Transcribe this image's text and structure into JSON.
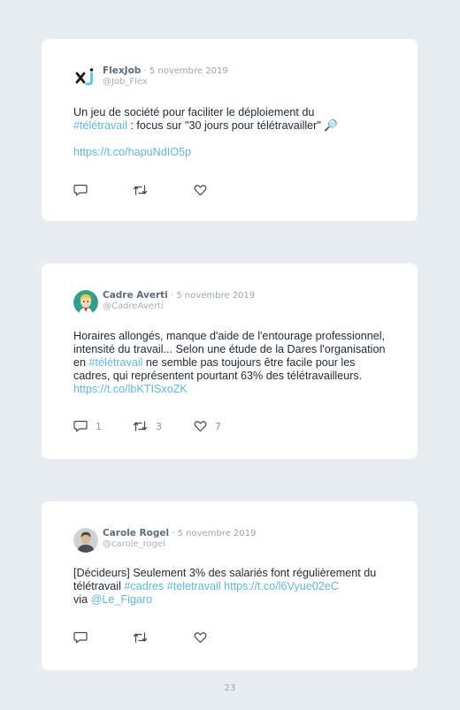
{
  "tweets": [
    {
      "author": "FlexJob",
      "date": " · 5 novembre 2019",
      "handle": "@Job_Flex",
      "avatar": "flexjob-logo",
      "text_a": "Un jeu de société pour faciliter le déploiement du",
      "hashtag": "#télétravail",
      "text_b": " : focus sur \"30 jours pour télétravailler\" 🔎",
      "link": "https://t.co/hapuNdIO5p",
      "replies": "",
      "retweets": "",
      "likes": ""
    },
    {
      "author": "Cadre Averti",
      "date": " · 5 novembre 2019",
      "handle": "@CadreAverti",
      "avatar": "cadre-averti-avatar",
      "text_a": "Horaires allongés, manque d'aide de l'entourage professionnel, intensité du travail... Selon une étude de la Dares l'organisation en ",
      "hashtag": "#télétravail",
      "text_b": " ne semble pas toujours être facile pour les cadres, qui représentent pourtant 63% des télétravailleurs. ",
      "link": "https://t.co/lbKTISxoZK",
      "replies": "1",
      "retweets": "3",
      "likes": "7"
    },
    {
      "author": "Carole Rogel",
      "date": " · 5 novembre 2019",
      "handle": "@carole_rogel",
      "avatar": "carole-rogel-photo",
      "text_a": "[Décideurs] Seulement 3% des salariés font régulièrement du télétravail ",
      "hashtag1": "#cadres",
      "hashtag2": "#teletravail",
      "link": "https://t.co/l6Vyue02eC",
      "text_b": "via ",
      "mention": "@Le_Figaro",
      "replies": "",
      "retweets": "",
      "likes": ""
    }
  ],
  "page_number": "23",
  "icons": [
    "reply-icon",
    "retweet-icon",
    "like-icon"
  ],
  "colors": {
    "background": "#e7edf1",
    "card": "#ffffff",
    "link": "#5db7e4",
    "text": "#1f2a33"
  }
}
